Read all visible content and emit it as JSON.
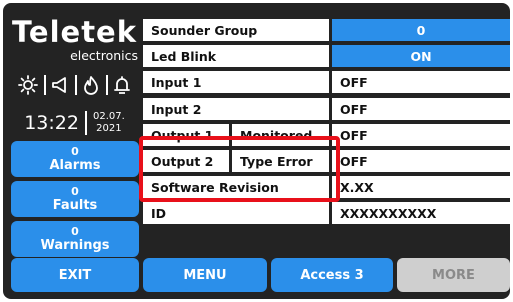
{
  "brand": {
    "name": "Teletek",
    "sub": "electronics"
  },
  "status_icons": [
    "sun-icon",
    "speaker-icon",
    "flame-icon",
    "bell-icon"
  ],
  "clock": {
    "time": "13:22",
    "date_line1": "02.07.",
    "date_line2": "2021"
  },
  "left_buttons": [
    {
      "count": "0",
      "label": "Alarms"
    },
    {
      "count": "0",
      "label": "Faults"
    },
    {
      "count": "0",
      "label": "Warnings"
    }
  ],
  "rows": [
    {
      "label": "Sounder Group",
      "value": "0"
    },
    {
      "label": "Led Blink",
      "value": "ON"
    },
    {
      "label": "Input 1",
      "value": "OFF"
    },
    {
      "label": "Input 2",
      "value": "OFF"
    },
    {
      "label": "Output 1",
      "mode": "Monitored",
      "value": "OFF"
    },
    {
      "label": "Output 2",
      "mode": "Type Error",
      "value": "OFF"
    },
    {
      "label": "Software Revision",
      "value": "X.XX"
    },
    {
      "label": "ID",
      "value": "XXXXXXXXXX"
    }
  ],
  "bottom": {
    "exit": "EXIT",
    "menu": "MENU",
    "access": "Access 3",
    "more": "MORE"
  },
  "colors": {
    "accent": "#2b8fea",
    "background": "#232323",
    "highlight": "#e8101a",
    "disabled": "#cfcfcf"
  }
}
